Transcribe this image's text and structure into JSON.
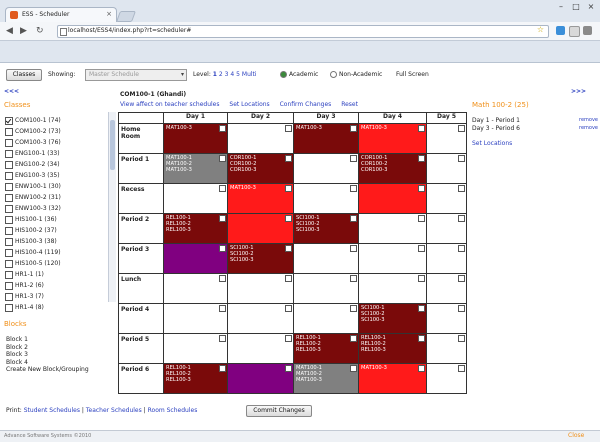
{
  "browser": {
    "tab_title": "ESS - Scheduler",
    "url": "localhost/ESS4/index.php?rt=scheduler#"
  },
  "toolbar": {
    "classes_button": "Classes",
    "showing_label": "Showing:",
    "schedule_select": "Master Schedule",
    "level_label": "Level:",
    "levels": [
      "1",
      "2",
      "3",
      "4",
      "5",
      "Multi"
    ],
    "academic_label": "Academic",
    "non_academic_label": "Non-Academic",
    "fullscreen_label": "Full Screen"
  },
  "left_panel": {
    "prev_nav": "<<<",
    "classes_heading": "Classes",
    "classes": [
      {
        "label": "COM100-1 (74)",
        "checked": true
      },
      {
        "label": "COM100-2 (73)",
        "checked": false
      },
      {
        "label": "COM100-3 (76)",
        "checked": false
      },
      {
        "label": "ENG100-1 (33)",
        "checked": false
      },
      {
        "label": "ENG100-2 (34)",
        "checked": false
      },
      {
        "label": "ENG100-3 (35)",
        "checked": false
      },
      {
        "label": "ENW100-1 (30)",
        "checked": false
      },
      {
        "label": "ENW100-2 (31)",
        "checked": false
      },
      {
        "label": "ENW100-3 (32)",
        "checked": false
      },
      {
        "label": "HIS100-1 (36)",
        "checked": false
      },
      {
        "label": "HIS100-2 (37)",
        "checked": false
      },
      {
        "label": "HIS100-3 (38)",
        "checked": false
      },
      {
        "label": "HIS100-4 (119)",
        "checked": false
      },
      {
        "label": "HIS100-5 (120)",
        "checked": false
      },
      {
        "label": "HR1-1 (1)",
        "checked": false
      },
      {
        "label": "HR1-2 (6)",
        "checked": false
      },
      {
        "label": "HR1-3 (7)",
        "checked": false
      },
      {
        "label": "HR1-4 (8)",
        "checked": false
      }
    ],
    "blocks_heading": "Blocks",
    "blocks": [
      "Block 1",
      "Block 2",
      "Block 3",
      "Block 4"
    ],
    "create_block": "Create New Block/Grouping"
  },
  "center": {
    "selected_class": "COM100-1 (Ghandi)",
    "links": [
      "View affect on teacher schedules",
      "Set Locations",
      "Confirm Changes",
      "Reset"
    ],
    "days": [
      "Day 1",
      "Day 2",
      "Day 3",
      "Day 4",
      "Day 5"
    ],
    "rows": [
      {
        "label": "Home Room",
        "cells": [
          {
            "bg": "#7a0a0a",
            "lines": [
              "MAT100-3"
            ]
          },
          {
            "bg": "#ffffff",
            "lines": []
          },
          {
            "bg": "#7a0a0a",
            "lines": [
              "MAT100-3"
            ]
          },
          {
            "bg": "#ff1a1a",
            "lines": [
              "MAT100-3"
            ]
          },
          {
            "bg": "#ffffff",
            "lines": []
          }
        ]
      },
      {
        "label": "Period 1",
        "cells": [
          {
            "bg": "#808080",
            "lines": [
              "MAT100-1",
              "MAT100-2",
              "MAT100-3"
            ]
          },
          {
            "bg": "#7a0a0a",
            "lines": [
              "COR100-1",
              "COR100-2",
              "COR100-3"
            ]
          },
          {
            "bg": "#ffffff",
            "lines": []
          },
          {
            "bg": "#7a0a0a",
            "lines": [
              "COR100-1",
              "COR100-2",
              "COR100-3"
            ]
          },
          {
            "bg": "#ffffff",
            "lines": []
          }
        ]
      },
      {
        "label": "Recess",
        "cells": [
          {
            "bg": "#ffffff",
            "lines": []
          },
          {
            "bg": "#ff1a1a",
            "lines": [
              "MAT100-3"
            ]
          },
          {
            "bg": "#ffffff",
            "lines": []
          },
          {
            "bg": "#ff1a1a",
            "lines": []
          },
          {
            "bg": "#ffffff",
            "lines": []
          }
        ]
      },
      {
        "label": "Period 2",
        "cells": [
          {
            "bg": "#7a0a0a",
            "lines": [
              "REL100-1",
              "REL100-2",
              "REL100-3"
            ]
          },
          {
            "bg": "#ff1a1a",
            "lines": []
          },
          {
            "bg": "#7a0a0a",
            "lines": [
              "SCI100-1",
              "SCI100-2",
              "SCI100-3"
            ]
          },
          {
            "bg": "#ffffff",
            "lines": []
          },
          {
            "bg": "#ffffff",
            "lines": []
          }
        ]
      },
      {
        "label": "Period 3",
        "cells": [
          {
            "bg": "#800080",
            "lines": []
          },
          {
            "bg": "#7a0a0a",
            "lines": [
              "SCI100-1",
              "SCI100-2",
              "SCI100-3"
            ]
          },
          {
            "bg": "#ffffff",
            "lines": []
          },
          {
            "bg": "#ffffff",
            "lines": []
          },
          {
            "bg": "#ffffff",
            "lines": []
          }
        ]
      },
      {
        "label": "Lunch",
        "cells": [
          {
            "bg": "#ffffff",
            "lines": []
          },
          {
            "bg": "#ffffff",
            "lines": []
          },
          {
            "bg": "#ffffff",
            "lines": []
          },
          {
            "bg": "#ffffff",
            "lines": []
          },
          {
            "bg": "#ffffff",
            "lines": []
          }
        ]
      },
      {
        "label": "Period 4",
        "cells": [
          {
            "bg": "#ffffff",
            "lines": []
          },
          {
            "bg": "#ffffff",
            "lines": []
          },
          {
            "bg": "#ffffff",
            "lines": []
          },
          {
            "bg": "#7a0a0a",
            "lines": [
              "SCI100-1",
              "SCI100-2",
              "SCI100-3"
            ]
          },
          {
            "bg": "#ffffff",
            "lines": []
          }
        ]
      },
      {
        "label": "Period 5",
        "cells": [
          {
            "bg": "#ffffff",
            "lines": []
          },
          {
            "bg": "#ffffff",
            "lines": []
          },
          {
            "bg": "#7a0a0a",
            "lines": [
              "REL100-1",
              "REL100-2",
              "REL100-3"
            ]
          },
          {
            "bg": "#7a0a0a",
            "lines": [
              "REL100-1",
              "REL100-2",
              "REL100-3"
            ]
          },
          {
            "bg": "#ffffff",
            "lines": []
          }
        ]
      },
      {
        "label": "Period 6",
        "cells": [
          {
            "bg": "#7a0a0a",
            "lines": [
              "REL100-1",
              "REL100-2",
              "REL100-3"
            ]
          },
          {
            "bg": "#800080",
            "lines": []
          },
          {
            "bg": "#808080",
            "lines": [
              "MAT100-1",
              "MAT100-2",
              "MAT100-3"
            ]
          },
          {
            "bg": "#ff1a1a",
            "lines": [
              "MAT100-3"
            ]
          },
          {
            "bg": "#ffffff",
            "lines": []
          }
        ]
      }
    ],
    "commit_button": "Commit Changes"
  },
  "right_panel": {
    "next_nav": ">>>",
    "heading": "Math 100-2 (25)",
    "items": [
      {
        "label": "Day 1 - Period 1",
        "action": "remove"
      },
      {
        "label": "Day 3 - Period 6",
        "action": "remove"
      }
    ],
    "set_locations": "Set Locations"
  },
  "footer": {
    "print_label": "Print:",
    "print_links": [
      "Student Schedules",
      "Teacher Schedules",
      "Room Schedules"
    ],
    "separator": "|",
    "copyright": "Advance Software Systems ©2010",
    "close": "Close"
  }
}
